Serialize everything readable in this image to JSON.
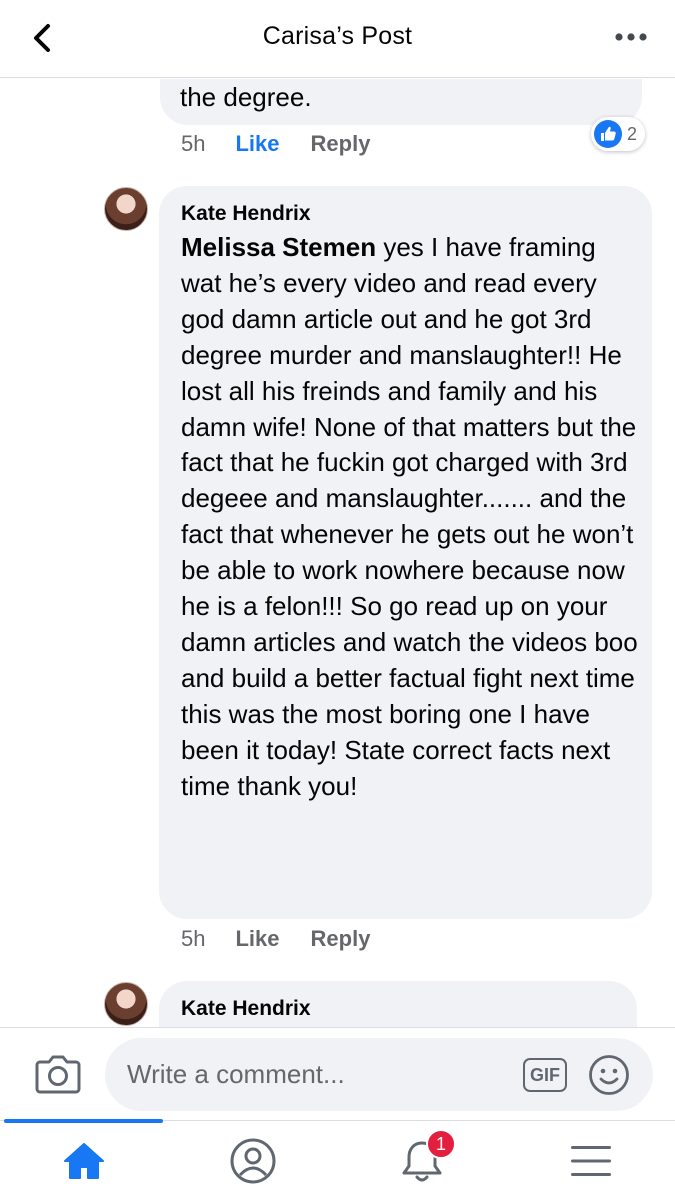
{
  "header": {
    "title": "Carisa’s Post"
  },
  "previous_comment": {
    "text_tail": "the degree.",
    "time": "5h",
    "like_label": "Like",
    "reply_label": "Reply",
    "reaction_count": "2",
    "reaction_icon": "thumbs-up-icon"
  },
  "comments": [
    {
      "author": "Kate Hendrix",
      "mention": "Melissa Stemen",
      "text": " yes I have framing wat he’s every video and read every god damn article  out and he got 3rd degree murder and manslaughter!! He lost all his freinds and family and his damn wife! None of that matters but the fact that he fuckin got charged with 3rd degeee and manslaughter....... and the fact that whenever he gets out he won’t be able to work nowhere because now he is a felon!!! So go read up on your damn articles and watch the videos boo and build a better factual fight next time this was the most boring one I have been it today! State correct facts next time thank you!",
      "time": "5h",
      "like_label": "Like",
      "reply_label": "Reply"
    },
    {
      "author": "Kate Hendrix"
    }
  ],
  "composer": {
    "placeholder": "Write a comment...",
    "gif_label": "GIF"
  },
  "nav": {
    "notification_count": "1"
  },
  "colors": {
    "accent": "#1877f2",
    "bubble": "#f0f2f5",
    "muted_text": "#65676b",
    "badge": "#e41e3f"
  }
}
